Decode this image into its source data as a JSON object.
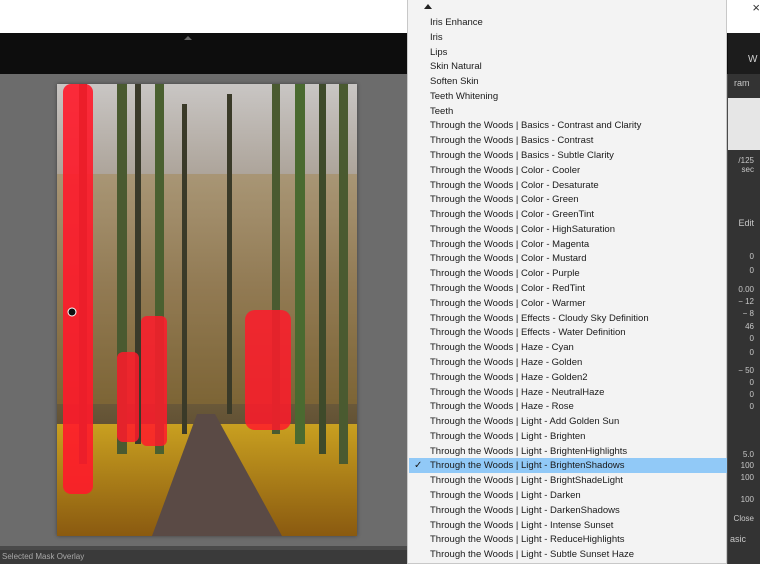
{
  "window": {
    "close_glyph": "×"
  },
  "status_bar": {
    "text": "Selected Mask Overlay"
  },
  "right_panel": {
    "top_label": "W",
    "histogram_tab": "ram",
    "shutter": "/125 sec",
    "edit_label": "Edit",
    "values": [
      "0",
      "0",
      "0.00",
      "− 12",
      "− 8",
      "46",
      "0",
      "0",
      "− 50",
      "0",
      "0",
      "0"
    ],
    "lower_values": [
      "5.0",
      "100",
      "100",
      "100"
    ],
    "close_label": "Close",
    "basic_label": "asic"
  },
  "menu": {
    "selected_index": 30,
    "items": [
      "Iris Enhance",
      "Iris",
      "Lips",
      "Skin Natural",
      "Soften Skin",
      "Teeth Whitening",
      "Teeth",
      "Through the Woods | Basics - Contrast and Clarity",
      "Through the Woods | Basics - Contrast",
      "Through the Woods | Basics - Subtle Clarity",
      "Through the Woods | Color - Cooler",
      "Through the Woods | Color - Desaturate",
      "Through the Woods | Color - Green",
      "Through the Woods | Color - GreenTint",
      "Through the Woods | Color - HighSaturation",
      "Through the Woods | Color - Magenta",
      "Through the Woods | Color - Mustard",
      "Through the Woods | Color - Purple",
      "Through the Woods | Color - RedTint",
      "Through the Woods | Color - Warmer",
      "Through the Woods | Effects - Cloudy Sky Definition",
      "Through the Woods | Effects - Water Definition",
      "Through the Woods | Haze - Cyan",
      "Through the Woods | Haze - Golden",
      "Through the Woods | Haze - Golden2",
      "Through the Woods | Haze - NeutralHaze",
      "Through the Woods | Haze - Rose",
      "Through the Woods | Light - Add Golden Sun",
      "Through the Woods | Light - Brighten",
      "Through the Woods | Light - BrightenHighlights",
      "Through the Woods | Light - BrightenShadows",
      "Through the Woods | Light - BrightShadeLight",
      "Through the Woods | Light - Darken",
      "Through the Woods | Light - DarkenShadows",
      "Through the Woods | Light - Intense Sunset",
      "Through the Woods | Light - ReduceHighlights",
      "Through the Woods | Light - Subtle Sunset Haze"
    ]
  }
}
